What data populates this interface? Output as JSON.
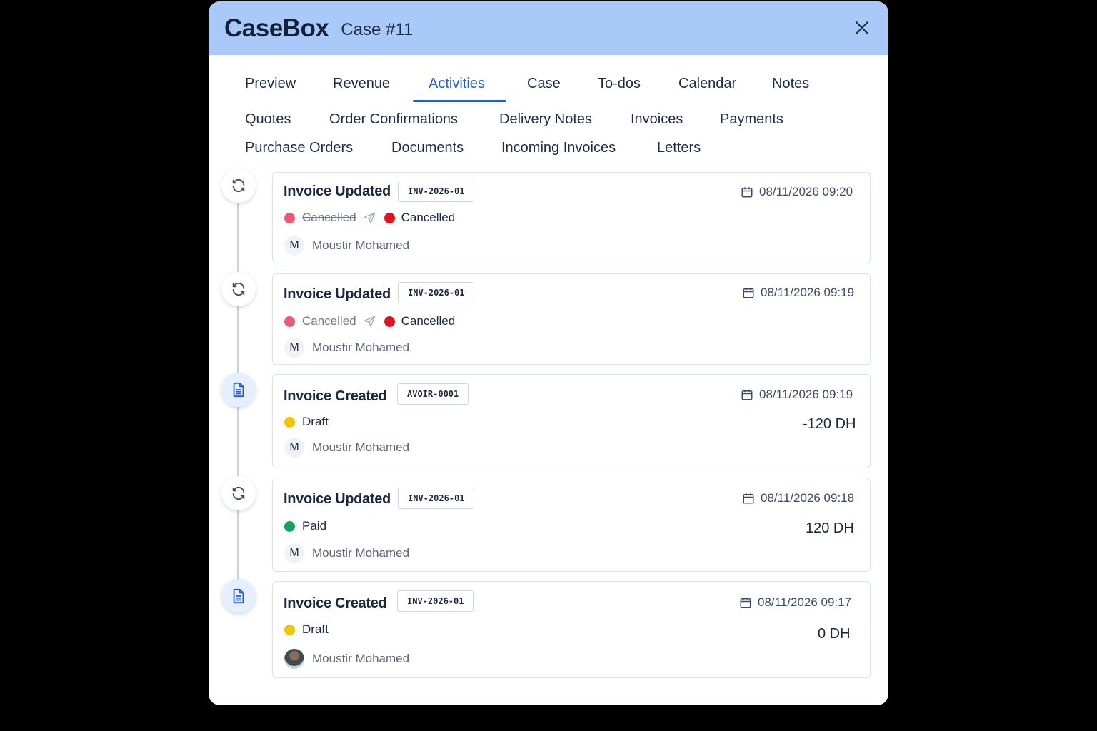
{
  "header": {
    "brand": "CaseBox",
    "case_label": "Case #11"
  },
  "tabs": [
    {
      "label": "Preview"
    },
    {
      "label": "Revenue"
    },
    {
      "label": "Activities",
      "active": true
    },
    {
      "label": "Case"
    },
    {
      "label": "To-dos"
    },
    {
      "label": "Calendar"
    },
    {
      "label": "Notes"
    },
    {
      "label": "Quotes"
    },
    {
      "label": "Order Confirmations"
    },
    {
      "label": "Delivery Notes"
    },
    {
      "label": "Invoices"
    },
    {
      "label": "Payments"
    },
    {
      "label": "Purchase Orders"
    },
    {
      "label": "Documents"
    },
    {
      "label": "Incoming Invoices"
    },
    {
      "label": "Letters"
    }
  ],
  "colors": {
    "accent": "#2a5bd7",
    "header_bg": "#a9c9f9",
    "status_cancelled_old": "#ea5a78",
    "status_cancelled": "#e3101d",
    "status_draft": "#f5c400",
    "status_paid": "#13a25c"
  },
  "activities": [
    {
      "icon": "refresh-icon",
      "title": "Invoice Updated",
      "ref": "INV-2026-01",
      "date": "08/11/2026 09:20",
      "old_status": "Cancelled",
      "new_status": "Cancelled",
      "user_initial": "M",
      "user": "Moustir Mohamed"
    },
    {
      "icon": "refresh-icon",
      "title": "Invoice Updated",
      "ref": "INV-2026-01",
      "date": "08/11/2026 09:19",
      "old_status": "Cancelled",
      "new_status": "Cancelled",
      "user_initial": "M",
      "user": "Moustir Mohamed"
    },
    {
      "icon": "document-icon",
      "title": "Invoice Created",
      "ref": "AVOIR-0001",
      "date": "08/11/2026 09:19",
      "status": "Draft",
      "amount": "-120 DH",
      "user_initial": "M",
      "user": "Moustir Mohamed"
    },
    {
      "icon": "refresh-icon",
      "title": "Invoice Updated",
      "ref": "INV-2026-01",
      "date": "08/11/2026 09:18",
      "status": "Paid",
      "amount": "120 DH",
      "user_initial": "M",
      "user": "Moustir Mohamed"
    },
    {
      "icon": "document-icon",
      "title": "Invoice Created",
      "ref": "INV-2026-01",
      "date": "08/11/2026 09:17",
      "status": "Draft",
      "amount": "0 DH",
      "user_avatar": "photo",
      "user": "Moustir Mohamed"
    }
  ]
}
